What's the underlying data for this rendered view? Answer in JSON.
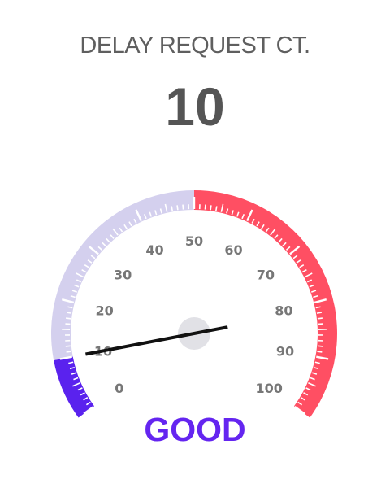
{
  "widget": {
    "title": "DELAY REQUEST CT.",
    "value": "10",
    "status": "GOOD",
    "status_color": "#6425f0"
  },
  "gauge": {
    "min": 0,
    "max": 100,
    "reading": 10,
    "tick_labels": [
      "0",
      "10",
      "20",
      "30",
      "40",
      "50",
      "60",
      "70",
      "80",
      "90",
      "100"
    ],
    "bands": [
      {
        "from": 0,
        "to": 10,
        "color": "#5a22ee"
      },
      {
        "from": 10,
        "to": 50,
        "color": "#d4d0ee"
      },
      {
        "from": 50,
        "to": 100,
        "color": "#ff4f63"
      }
    ],
    "needle_color": "#111111",
    "hub_color": "#e1e1e6"
  }
}
